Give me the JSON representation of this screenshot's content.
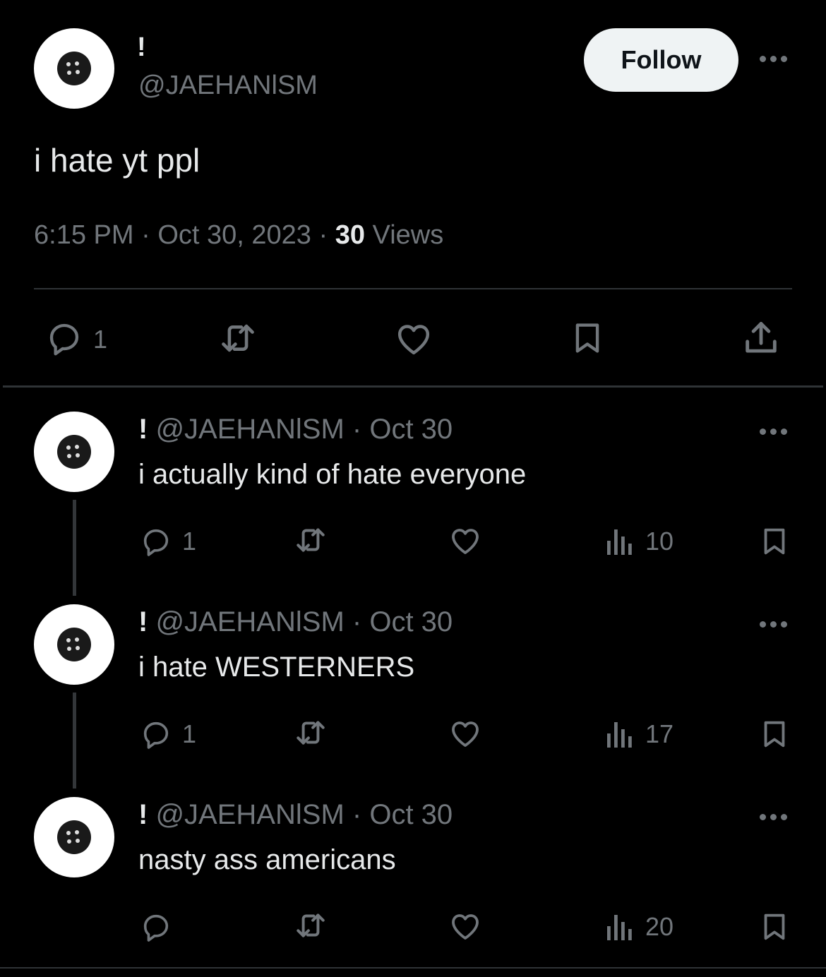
{
  "main_tweet": {
    "display_name": "!",
    "handle": "@JAEHANlSM",
    "follow_label": "Follow",
    "text": "i hate yt ppl",
    "time": "6:15 PM",
    "date": "Oct 30, 2023",
    "views_count": "30",
    "views_label": "Views",
    "reply_count": "1"
  },
  "replies": [
    {
      "display_name": "!",
      "handle": "@JAEHANlSM",
      "date": "Oct 30",
      "text": "i actually kind of hate everyone",
      "reply_count": "1",
      "views": "10"
    },
    {
      "display_name": "!",
      "handle": "@JAEHANlSM",
      "date": "Oct 30",
      "text": "i hate WESTERNERS",
      "reply_count": "1",
      "views": "17"
    },
    {
      "display_name": "!",
      "handle": "@JAEHANlSM",
      "date": "Oct 30",
      "text": "nasty ass americans",
      "reply_count": "",
      "views": "20"
    }
  ],
  "colors": {
    "background": "#000000",
    "text": "#e7e9ea",
    "secondary": "#71767b",
    "divider": "#2f3336",
    "follow_bg": "#eff3f4"
  }
}
